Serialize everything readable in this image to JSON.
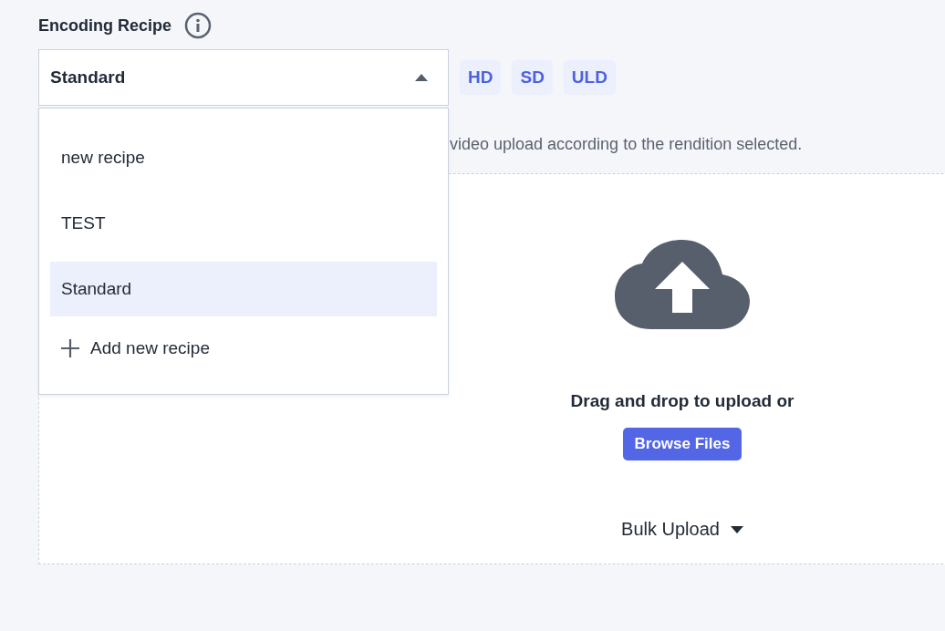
{
  "recipe": {
    "label": "Encoding Recipe",
    "value": "Standard",
    "expanded": true,
    "options": [
      {
        "label": "new recipe",
        "selected": false
      },
      {
        "label": "TEST",
        "selected": false
      },
      {
        "label": "Standard",
        "selected": true
      }
    ],
    "add_label": "Add new recipe"
  },
  "renditions": [
    "HD",
    "SD",
    "ULD"
  ],
  "description": "video upload according to the rendition selected.",
  "upload": {
    "prompt": "Drag and drop to upload or",
    "browse_button": "Browse Files",
    "bulk_upload": "Bulk Upload"
  }
}
